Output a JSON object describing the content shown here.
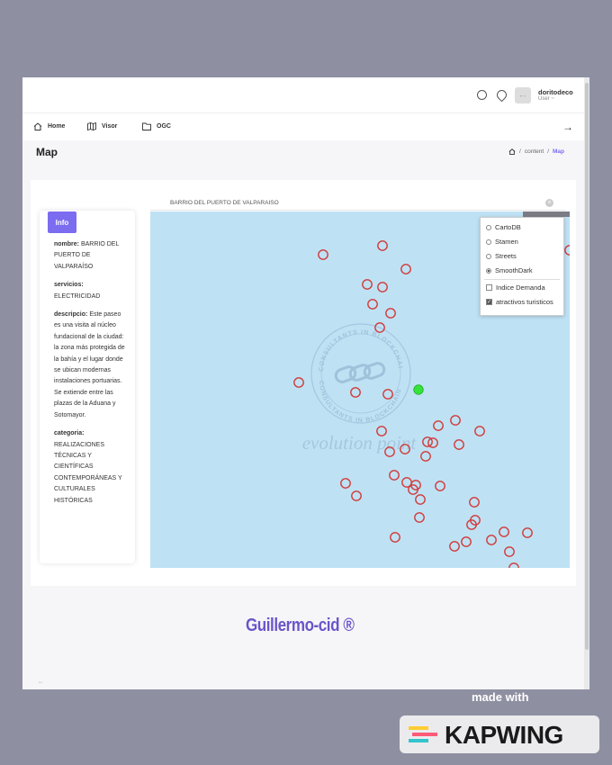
{
  "topbar": {
    "user_name": "doritodeco",
    "user_role": "User ~",
    "avatar_text": "⌐ ¬"
  },
  "nav": {
    "home": "Home",
    "visor": "Visor",
    "ogc": "OGC"
  },
  "page": {
    "title": "Map",
    "breadcrumb_1": "content",
    "breadcrumb_2": "Map"
  },
  "info": {
    "button": "Info",
    "nombre_label": "nombre:",
    "nombre_value": "BARRIO DEL PUERTO DE VALPARAÍSO",
    "servicios_label": "servicios:",
    "servicios_value": "ELECTRICIDAD",
    "descripcio_label": "descripcio:",
    "descripcio_value": "Este paseo es una visita al núcleo fundacional de la ciudad: la zona más protegida de la bahía y el lugar donde se ubican modernas instalaciones portuarias. Se extiende entre las plazas de la Aduana y Sotomayor.",
    "categoria_label": "categoria:",
    "categoria_value": "REALIZACIONES TÉCNICAS Y CIENTÍFICAS CONTEMPORÁNEAS Y CULTURALES HISTÓRICAS"
  },
  "map": {
    "search_text": "BARRIO DEL PUERTO DE VALPARAISO",
    "watermark_ring_top": "CONSULTANTS IN BLOCKCHAIN",
    "watermark_ring_bottom": "CONSULTANTS IN BLOCKCHAIN",
    "watermark_text": "evolution point",
    "marker_color": "#d23b3b",
    "selected_color": "#35e33a",
    "water_color": "#bee2f4",
    "base_layers": [
      "CartoDB",
      "Stamen",
      "Streets",
      "SmoothDark"
    ],
    "selected_base_layer": "SmoothDark",
    "overlays": [
      {
        "label": "Indice Demanda",
        "checked": false
      },
      {
        "label": "atractivos turisticos",
        "checked": true
      }
    ]
  },
  "footer": {
    "expand_handle": "↔",
    "signature": "Guillermo-cid ®",
    "made_with": "made with",
    "brand": "KAPWING"
  },
  "colors": {
    "accent": "#7b6cf0",
    "background": "#8e90a2"
  }
}
